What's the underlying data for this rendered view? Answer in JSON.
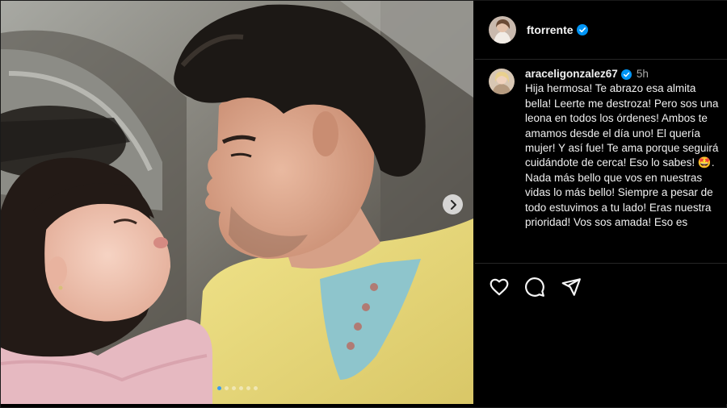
{
  "post": {
    "author": "ftorrente",
    "author_verified": true,
    "carousel_dots": 6,
    "carousel_active_index": 0
  },
  "comment": {
    "username": "araceligonzalez67",
    "verified": true,
    "time": "5h",
    "text": "Hija hermosa! Te abrazo esa almita bella! Leerte me destroza! Pero sos una leona en todos los órdenes! Ambos te amamos desde el día uno! El quería mujer! Y así fue! Te ama porque seguirá cuidándote de cerca! Eso lo sabes! 🤩. Nada más bello que vos en nuestras vidas lo más bello! Siempre a pesar de todo estuvimos a tu lado! Eras nuestra prioridad! Vos sos amada! Eso es"
  },
  "actions": [
    "heart-icon",
    "comment-icon",
    "share-icon"
  ],
  "colors": {
    "background": "#000000",
    "verified": "#0095f6",
    "divider": "#262626",
    "muted_text": "#a8a8a8",
    "sweater": "#e8dc7a",
    "shirt": "#8ec5cc"
  }
}
